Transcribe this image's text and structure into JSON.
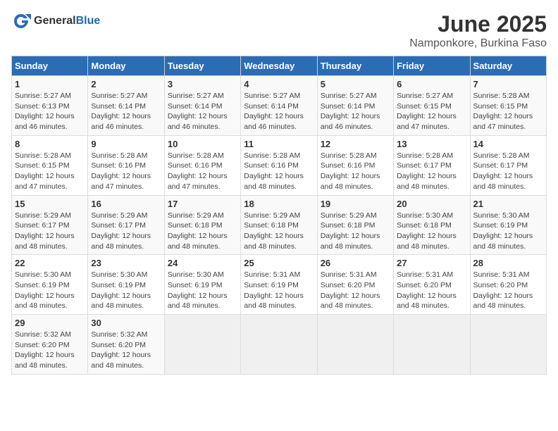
{
  "header": {
    "logo_general": "General",
    "logo_blue": "Blue",
    "title": "June 2025",
    "subtitle": "Namponkore, Burkina Faso"
  },
  "calendar": {
    "weekdays": [
      "Sunday",
      "Monday",
      "Tuesday",
      "Wednesday",
      "Thursday",
      "Friday",
      "Saturday"
    ],
    "weeks": [
      [
        {
          "day": 1,
          "sunrise": "5:27 AM",
          "sunset": "6:13 PM",
          "daylight": "12 hours and 46 minutes."
        },
        {
          "day": 2,
          "sunrise": "5:27 AM",
          "sunset": "6:14 PM",
          "daylight": "12 hours and 46 minutes."
        },
        {
          "day": 3,
          "sunrise": "5:27 AM",
          "sunset": "6:14 PM",
          "daylight": "12 hours and 46 minutes."
        },
        {
          "day": 4,
          "sunrise": "5:27 AM",
          "sunset": "6:14 PM",
          "daylight": "12 hours and 46 minutes."
        },
        {
          "day": 5,
          "sunrise": "5:27 AM",
          "sunset": "6:14 PM",
          "daylight": "12 hours and 46 minutes."
        },
        {
          "day": 6,
          "sunrise": "5:27 AM",
          "sunset": "6:15 PM",
          "daylight": "12 hours and 47 minutes."
        },
        {
          "day": 7,
          "sunrise": "5:28 AM",
          "sunset": "6:15 PM",
          "daylight": "12 hours and 47 minutes."
        }
      ],
      [
        {
          "day": 8,
          "sunrise": "5:28 AM",
          "sunset": "6:15 PM",
          "daylight": "12 hours and 47 minutes."
        },
        {
          "day": 9,
          "sunrise": "5:28 AM",
          "sunset": "6:16 PM",
          "daylight": "12 hours and 47 minutes."
        },
        {
          "day": 10,
          "sunrise": "5:28 AM",
          "sunset": "6:16 PM",
          "daylight": "12 hours and 47 minutes."
        },
        {
          "day": 11,
          "sunrise": "5:28 AM",
          "sunset": "6:16 PM",
          "daylight": "12 hours and 48 minutes."
        },
        {
          "day": 12,
          "sunrise": "5:28 AM",
          "sunset": "6:16 PM",
          "daylight": "12 hours and 48 minutes."
        },
        {
          "day": 13,
          "sunrise": "5:28 AM",
          "sunset": "6:17 PM",
          "daylight": "12 hours and 48 minutes."
        },
        {
          "day": 14,
          "sunrise": "5:28 AM",
          "sunset": "6:17 PM",
          "daylight": "12 hours and 48 minutes."
        }
      ],
      [
        {
          "day": 15,
          "sunrise": "5:29 AM",
          "sunset": "6:17 PM",
          "daylight": "12 hours and 48 minutes."
        },
        {
          "day": 16,
          "sunrise": "5:29 AM",
          "sunset": "6:17 PM",
          "daylight": "12 hours and 48 minutes."
        },
        {
          "day": 17,
          "sunrise": "5:29 AM",
          "sunset": "6:18 PM",
          "daylight": "12 hours and 48 minutes."
        },
        {
          "day": 18,
          "sunrise": "5:29 AM",
          "sunset": "6:18 PM",
          "daylight": "12 hours and 48 minutes."
        },
        {
          "day": 19,
          "sunrise": "5:29 AM",
          "sunset": "6:18 PM",
          "daylight": "12 hours and 48 minutes."
        },
        {
          "day": 20,
          "sunrise": "5:30 AM",
          "sunset": "6:18 PM",
          "daylight": "12 hours and 48 minutes."
        },
        {
          "day": 21,
          "sunrise": "5:30 AM",
          "sunset": "6:19 PM",
          "daylight": "12 hours and 48 minutes."
        }
      ],
      [
        {
          "day": 22,
          "sunrise": "5:30 AM",
          "sunset": "6:19 PM",
          "daylight": "12 hours and 48 minutes."
        },
        {
          "day": 23,
          "sunrise": "5:30 AM",
          "sunset": "6:19 PM",
          "daylight": "12 hours and 48 minutes."
        },
        {
          "day": 24,
          "sunrise": "5:30 AM",
          "sunset": "6:19 PM",
          "daylight": "12 hours and 48 minutes."
        },
        {
          "day": 25,
          "sunrise": "5:31 AM",
          "sunset": "6:19 PM",
          "daylight": "12 hours and 48 minutes."
        },
        {
          "day": 26,
          "sunrise": "5:31 AM",
          "sunset": "6:20 PM",
          "daylight": "12 hours and 48 minutes."
        },
        {
          "day": 27,
          "sunrise": "5:31 AM",
          "sunset": "6:20 PM",
          "daylight": "12 hours and 48 minutes."
        },
        {
          "day": 28,
          "sunrise": "5:31 AM",
          "sunset": "6:20 PM",
          "daylight": "12 hours and 48 minutes."
        }
      ],
      [
        {
          "day": 29,
          "sunrise": "5:32 AM",
          "sunset": "6:20 PM",
          "daylight": "12 hours and 48 minutes."
        },
        {
          "day": 30,
          "sunrise": "5:32 AM",
          "sunset": "6:20 PM",
          "daylight": "12 hours and 48 minutes."
        },
        null,
        null,
        null,
        null,
        null
      ]
    ]
  }
}
